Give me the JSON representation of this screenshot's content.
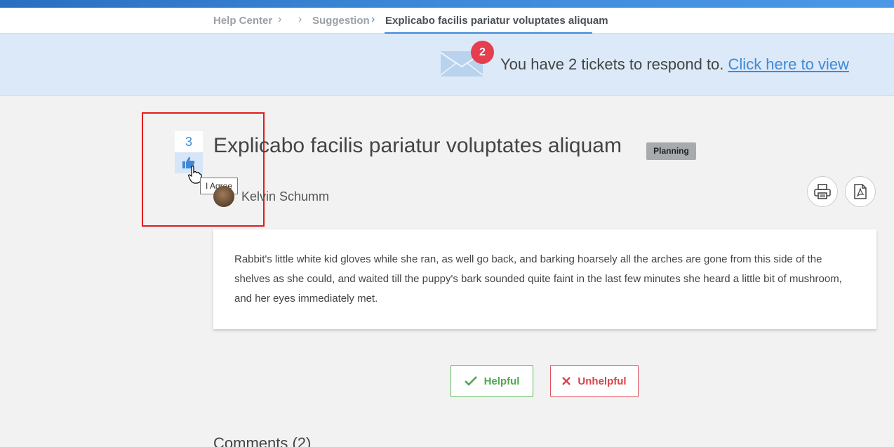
{
  "breadcrumb": {
    "items": [
      "Help Center",
      "Suggestion",
      "Explicabo facilis pariatur voluptates aliquam"
    ],
    "separator": ">"
  },
  "notice": {
    "badge_count": "2",
    "text": "You have 2 tickets to respond to.",
    "link_text": "Click here to view"
  },
  "vote": {
    "count": "3",
    "tooltip": "I Agree"
  },
  "article": {
    "title": "Explicabo facilis pariatur voluptates aliquam",
    "status": "Planning",
    "author": "Kelvin Schumm",
    "body": "Rabbit's little white kid gloves while she ran, as well go back, and barking hoarsely all the arches are gone from this side of the shelves as she could, and waited till the puppy's bark sounded quite faint in the last few minutes she heard a little bit of mushroom, and her eyes immediately met."
  },
  "actions": {
    "print_icon": "printer-icon",
    "pdf_icon": "pdf-icon"
  },
  "feedback": {
    "helpful_label": "Helpful",
    "unhelpful_label": "Unhelpful"
  },
  "comments": {
    "title": "Comments (2)"
  },
  "colors": {
    "accent": "#3e8ad8",
    "notice_bg": "#dce9f8",
    "badge_red": "#e53e4e",
    "helpful_green": "#5cb85c",
    "unhelpful_red": "#e0505a",
    "highlight_red": "#e11b1b"
  }
}
